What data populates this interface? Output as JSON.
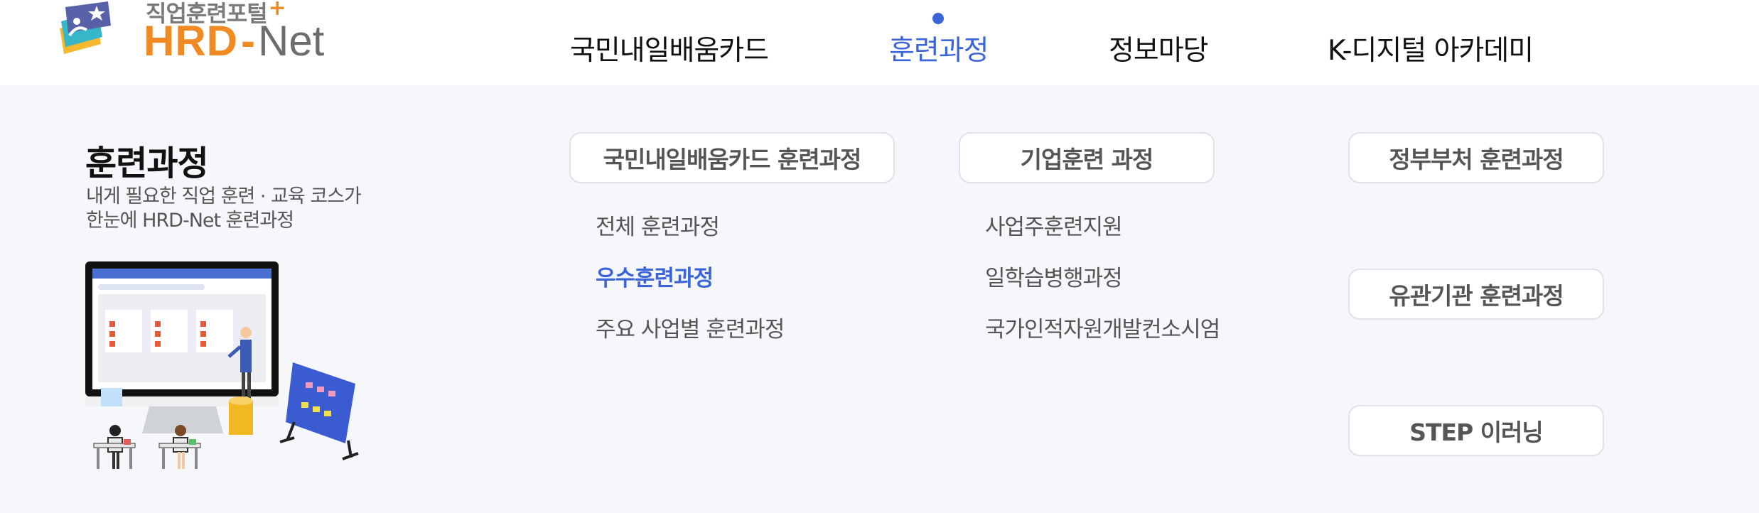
{
  "header": {
    "logo": {
      "subtitle": "직업훈련포털",
      "plus": "+",
      "brand_main": "HRD",
      "brand_dash": "-",
      "brand_net": "Net"
    },
    "nav": [
      {
        "label": "국민내일배움카드",
        "active": false
      },
      {
        "label": "훈련과정",
        "active": true
      },
      {
        "label": "정보마당",
        "active": false
      },
      {
        "label": "K-디지털 아카데미",
        "active": false
      }
    ]
  },
  "mega_menu": {
    "title": "훈련과정",
    "description_line1": "내게 필요한 직업 훈련 · 교육 코스가",
    "description_line2": "한눈에 HRD-Net 훈련과정",
    "columns": [
      {
        "category": "국민내일배움카드 훈련과정",
        "links": [
          {
            "label": "전체 훈련과정",
            "active": false
          },
          {
            "label": "우수훈련과정",
            "active": true
          },
          {
            "label": "주요 사업별 훈련과정",
            "active": false
          }
        ]
      },
      {
        "category": "기업훈련 과정",
        "links": [
          {
            "label": "사업주훈련지원",
            "active": false
          },
          {
            "label": "일학습병행과정",
            "active": false
          },
          {
            "label": "국가인적자원개발컨소시엄",
            "active": false
          }
        ]
      }
    ],
    "side_categories": [
      {
        "label": "정부부처 훈련과정"
      },
      {
        "label": "유관기관 훈련과정"
      },
      {
        "label": "STEP 이러닝"
      }
    ]
  },
  "colors": {
    "accent": "#3a64d8",
    "brand_orange": "#f08a24",
    "menu_bg": "#f6f7fb"
  }
}
